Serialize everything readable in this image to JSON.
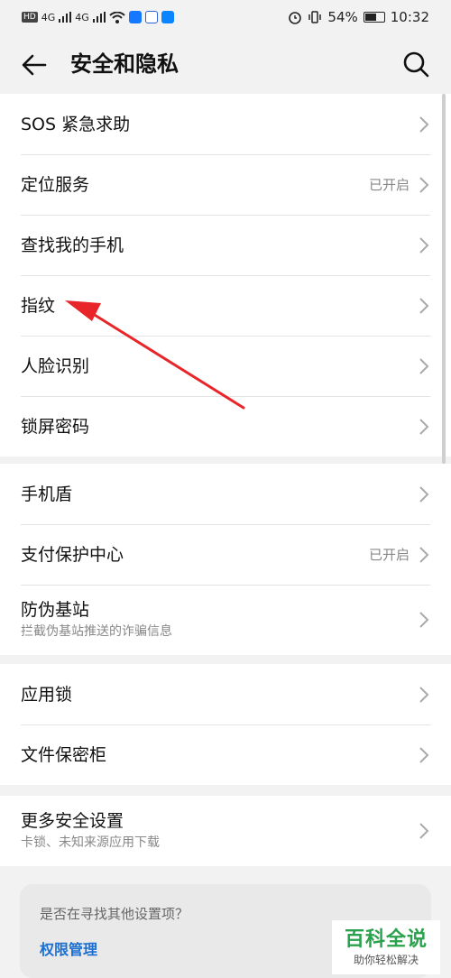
{
  "status_bar": {
    "network_tag": "HD",
    "sim1": "4G",
    "sim2": "4G",
    "battery_percent": "54%",
    "battery_level": 0.54,
    "time": "10:32",
    "icons": [
      "wifi-icon",
      "shield-app-icon",
      "baidu-app-icon",
      "zhihu-app-icon",
      "alarm-icon",
      "vibrate-icon"
    ]
  },
  "header": {
    "title": "安全和隐私",
    "back_icon": "back-arrow-icon",
    "search_icon": "search-icon"
  },
  "groups": [
    {
      "items": [
        {
          "label": "SOS 紧急求助",
          "status": ""
        },
        {
          "label": "定位服务",
          "status": "已开启"
        },
        {
          "label": "查找我的手机",
          "status": ""
        },
        {
          "label": "指纹",
          "status": ""
        },
        {
          "label": "人脸识别",
          "status": ""
        },
        {
          "label": "锁屏密码",
          "status": ""
        }
      ]
    },
    {
      "items": [
        {
          "label": "手机盾",
          "status": ""
        },
        {
          "label": "支付保护中心",
          "status": "已开启"
        },
        {
          "label": "防伪基站",
          "sub": "拦截伪基站推送的诈骗信息",
          "status": ""
        }
      ]
    },
    {
      "items": [
        {
          "label": "应用锁",
          "status": ""
        },
        {
          "label": "文件保密柜",
          "status": ""
        }
      ]
    },
    {
      "items": [
        {
          "label": "更多安全设置",
          "sub": "卡锁、未知来源应用下载",
          "status": ""
        }
      ]
    }
  ],
  "suggestion": {
    "question": "是否在寻找其他设置项？",
    "link": "权限管理"
  },
  "watermark": {
    "title": "百科全说",
    "subtitle": "助你轻松解决"
  },
  "colors": {
    "background": "#f2f2f2",
    "card": "#ffffff",
    "link": "#1b6fd0",
    "annotation_arrow": "#e8262a",
    "watermark_green": "#2aa14c"
  }
}
